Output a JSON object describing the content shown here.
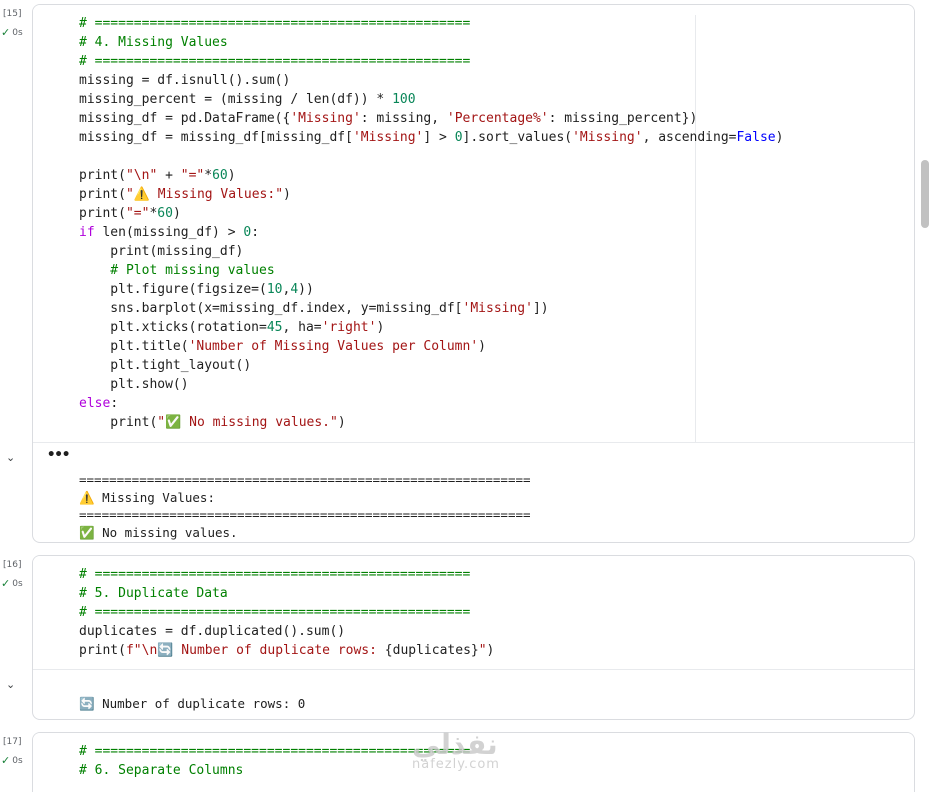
{
  "cells": [
    {
      "exec_count": "[15]",
      "status": "0s",
      "code": [
        [
          [
            "c",
            "# ================================================"
          ]
        ],
        [
          [
            "c",
            "# 4. Missing Values"
          ]
        ],
        [
          [
            "c",
            "# ================================================"
          ]
        ],
        [
          [
            "p",
            "missing = df.isnull().sum()"
          ]
        ],
        [
          [
            "p",
            "missing_percent = (missing / len(df)) * "
          ],
          [
            "n",
            "100"
          ]
        ],
        [
          [
            "p",
            "missing_df = pd.DataFrame({"
          ],
          [
            "s",
            "'Missing'"
          ],
          [
            "p",
            ": missing, "
          ],
          [
            "s",
            "'Percentage%'"
          ],
          [
            "p",
            ": missing_percent})"
          ]
        ],
        [
          [
            "p",
            "missing_df = missing_df[missing_df["
          ],
          [
            "s",
            "'Missing'"
          ],
          [
            "p",
            "] > "
          ],
          [
            "n",
            "0"
          ],
          [
            "p",
            "].sort_values("
          ],
          [
            "s",
            "'Missing'"
          ],
          [
            "p",
            ", ascending="
          ],
          [
            "k",
            "False"
          ],
          [
            "p",
            ")"
          ]
        ],
        [
          [
            "p",
            ""
          ]
        ],
        [
          [
            "p",
            "print("
          ],
          [
            "s",
            "\"\\n\""
          ],
          [
            "p",
            " + "
          ],
          [
            "s",
            "\"=\""
          ],
          [
            "p",
            "*"
          ],
          [
            "n",
            "60"
          ],
          [
            "p",
            ")"
          ]
        ],
        [
          [
            "p",
            "print("
          ],
          [
            "s",
            "\"⚠️ Missing Values:\""
          ],
          [
            "p",
            ")"
          ]
        ],
        [
          [
            "p",
            "print("
          ],
          [
            "s",
            "\"=\""
          ],
          [
            "p",
            "*"
          ],
          [
            "n",
            "60"
          ],
          [
            "p",
            ")"
          ]
        ],
        [
          [
            "kw",
            "if"
          ],
          [
            "p",
            " len(missing_df) > "
          ],
          [
            "n",
            "0"
          ],
          [
            "p",
            ":"
          ]
        ],
        [
          [
            "p",
            "    print(missing_df)"
          ]
        ],
        [
          [
            "c",
            "    # Plot missing values"
          ]
        ],
        [
          [
            "p",
            "    plt.figure(figsize=("
          ],
          [
            "n",
            "10"
          ],
          [
            "p",
            ","
          ],
          [
            "n",
            "4"
          ],
          [
            "p",
            "))"
          ]
        ],
        [
          [
            "p",
            "    sns.barplot(x=missing_df.index, y=missing_df["
          ],
          [
            "s",
            "'Missing'"
          ],
          [
            "p",
            "])"
          ]
        ],
        [
          [
            "p",
            "    plt.xticks(rotation="
          ],
          [
            "n",
            "45"
          ],
          [
            "p",
            ", ha="
          ],
          [
            "s",
            "'right'"
          ],
          [
            "p",
            ")"
          ]
        ],
        [
          [
            "p",
            "    plt.title("
          ],
          [
            "s",
            "'Number of Missing Values per Column'"
          ],
          [
            "p",
            ")"
          ]
        ],
        [
          [
            "p",
            "    plt.tight_layout()"
          ]
        ],
        [
          [
            "p",
            "    plt.show()"
          ]
        ],
        [
          [
            "kw",
            "else"
          ],
          [
            "p",
            ":"
          ]
        ],
        [
          [
            "p",
            "    print("
          ],
          [
            "s",
            "\"✅ No missing values.\""
          ],
          [
            "p",
            ")"
          ]
        ]
      ],
      "output": [
        "============================================================",
        "⚠️ Missing Values:",
        "============================================================",
        "✅ No missing values."
      ]
    },
    {
      "exec_count": "[16]",
      "status": "0s",
      "code": [
        [
          [
            "c",
            "# ================================================"
          ]
        ],
        [
          [
            "c",
            "# 5. Duplicate Data"
          ]
        ],
        [
          [
            "c",
            "# ================================================"
          ]
        ],
        [
          [
            "p",
            "duplicates = df.duplicated().sum()"
          ]
        ],
        [
          [
            "p",
            "print("
          ],
          [
            "s",
            "f\"\\n🔄 Number of duplicate rows: "
          ],
          [
            "p",
            "{duplicates}"
          ],
          [
            "s",
            "\""
          ],
          [
            "p",
            ")"
          ]
        ]
      ],
      "output": [
        "🔄 Number of duplicate rows: 0"
      ]
    },
    {
      "exec_count": "[17]",
      "status": "0s",
      "code": [
        [
          [
            "c",
            "# ================================================"
          ]
        ],
        [
          [
            "c",
            "# 6. Separate Columns"
          ]
        ]
      ]
    }
  ],
  "watermark": {
    "arabic": "نفذلي",
    "latin": "nafezly.com"
  },
  "colors": {
    "comment": "#008000",
    "string": "#a31515",
    "number": "#098658",
    "keyword": "#0000ff",
    "control": "#af00db"
  }
}
